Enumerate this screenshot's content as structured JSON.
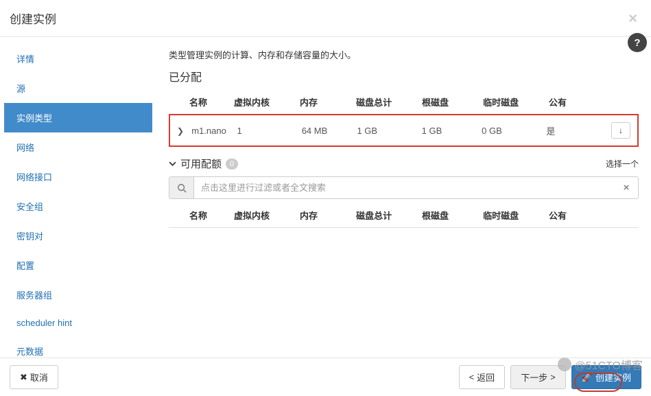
{
  "header": {
    "title": "创建实例"
  },
  "sidebar": {
    "items": [
      {
        "label": "详情"
      },
      {
        "label": "源"
      },
      {
        "label": "实例类型"
      },
      {
        "label": "网络"
      },
      {
        "label": "网络接口"
      },
      {
        "label": "安全组"
      },
      {
        "label": "密钥对"
      },
      {
        "label": "配置"
      },
      {
        "label": "服务器组"
      },
      {
        "label": "scheduler hint"
      },
      {
        "label": "元数据"
      }
    ],
    "activeIndex": 2
  },
  "main": {
    "description": "类型管理实例的计算、内存和存储容量的大小。",
    "allocated_title": "已分配",
    "columns": {
      "name": "名称",
      "vcpus": "虚拟内核",
      "memory": "内存",
      "total_disk": "磁盘总计",
      "root_disk": "根磁盘",
      "ephemeral": "临时磁盘",
      "public": "公有"
    },
    "allocated_row": {
      "name": "m1.nano",
      "vcpus": "1",
      "memory": "64 MB",
      "total_disk": "1 GB",
      "root_disk": "1 GB",
      "ephemeral": "0 GB",
      "public": "是"
    },
    "available": {
      "title": "可用配额",
      "count": "0",
      "select_one": "选择一个",
      "filter_placeholder": "点击这里进行过滤或者全文搜索"
    }
  },
  "footer": {
    "cancel": "取消",
    "back": "返回",
    "next": "下一步",
    "submit": "创建实例"
  },
  "watermark": "@51CTO博客"
}
